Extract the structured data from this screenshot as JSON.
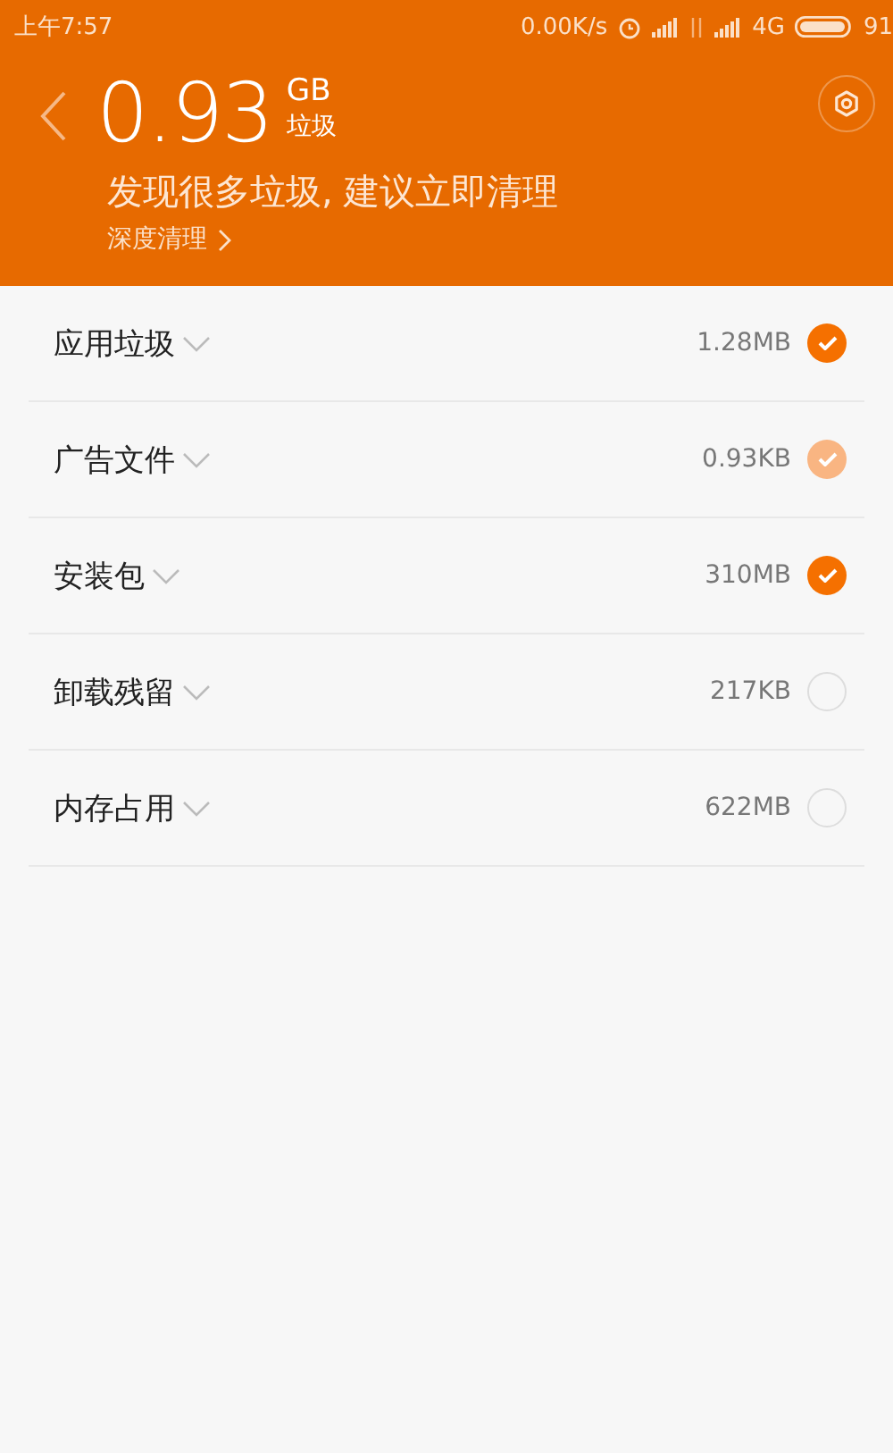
{
  "status_bar": {
    "time": "上午7:57",
    "speed": "0.00K/s",
    "network": "4G",
    "battery": "91"
  },
  "header": {
    "amount": "0.93",
    "unit": "GB",
    "unit_label": "垃圾",
    "message": "发现很多垃圾, 建议立即清理",
    "deep_clean": "深度清理"
  },
  "items": [
    {
      "name": "应用垃圾",
      "size": "1.28MB",
      "checked": true,
      "disabled": false
    },
    {
      "name": "广告文件",
      "size": "0.93KB",
      "checked": true,
      "disabled": true
    },
    {
      "name": "安装包",
      "size": "310MB",
      "checked": true,
      "disabled": false
    },
    {
      "name": "卸载残留",
      "size": "217KB",
      "checked": false,
      "disabled": false
    },
    {
      "name": "内存占用",
      "size": "622MB",
      "checked": false,
      "disabled": false
    }
  ]
}
